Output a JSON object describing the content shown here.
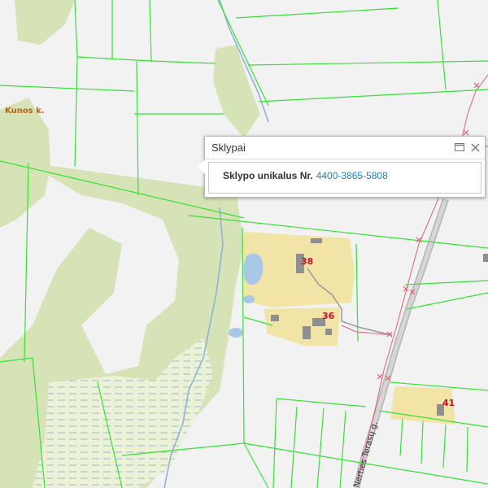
{
  "map": {
    "village_label": "Kunos k.",
    "street_label": "Nerties Terasų g.",
    "house_numbers": [
      "38",
      "36",
      "41"
    ],
    "colors": {
      "background": "#f2f2f2",
      "forest": "#d6e3b6",
      "meadow": "#ecf2d6",
      "parcel_fill": "#f2e3a6",
      "building": "#8f8f8f",
      "parcel_border": "#35e135",
      "water": "#a9c8e8",
      "road": "#b4b4b4",
      "power_line": "#e06070",
      "house_number": "#c8102e",
      "village_label": "#b5651d"
    }
  },
  "popup": {
    "title": "Sklypai",
    "field_label": "Sklypo unikalus Nr.",
    "field_value": "4400-3865-5808",
    "link_color": "#1a7fc0"
  }
}
